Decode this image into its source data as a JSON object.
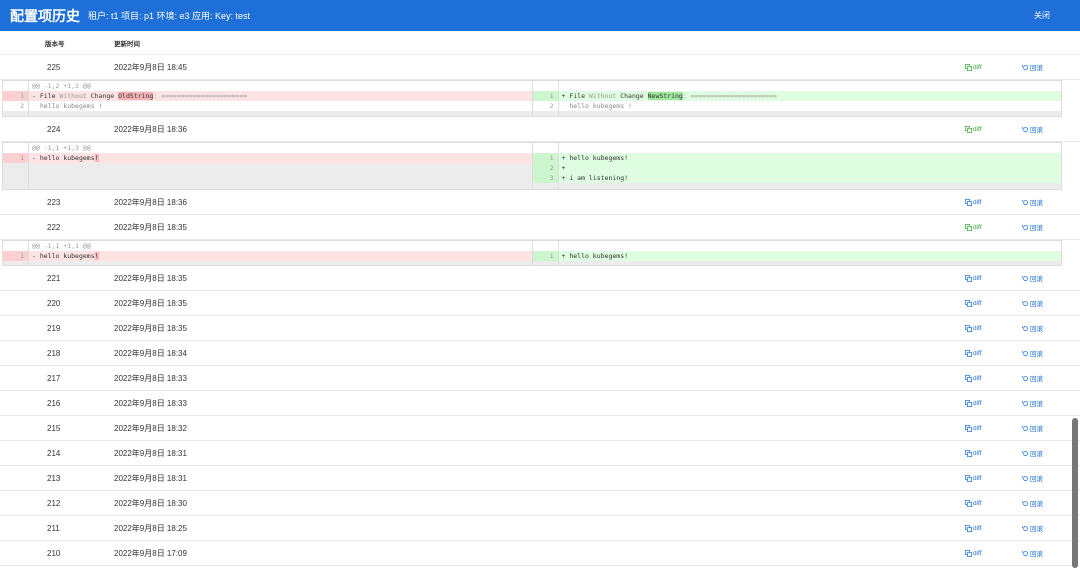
{
  "header": {
    "title": "配置项历史",
    "subtitle": "租户: t1 项目: p1 环境: e3 应用: Key: test",
    "close_label": "关闭"
  },
  "table": {
    "columns": [
      "版本号",
      "更新时间"
    ],
    "diff_label": "diff",
    "rollback_label": "回滚",
    "rows": [
      {
        "version": "225",
        "time": "2022年9月8日 18:45"
      },
      {
        "version": "224",
        "time": "2022年9月8日 18:36"
      },
      {
        "version": "223",
        "time": "2022年9月8日 18:36"
      },
      {
        "version": "222",
        "time": "2022年9月8日 18:35"
      },
      {
        "version": "221",
        "time": "2022年9月8日 18:35"
      },
      {
        "version": "220",
        "time": "2022年9月8日 18:35"
      },
      {
        "version": "219",
        "time": "2022年9月8日 18:35"
      },
      {
        "version": "218",
        "time": "2022年9月8日 18:34"
      },
      {
        "version": "217",
        "time": "2022年9月8日 18:33"
      },
      {
        "version": "216",
        "time": "2022年9月8日 18:33"
      },
      {
        "version": "215",
        "time": "2022年9月8日 18:32"
      },
      {
        "version": "214",
        "time": "2022年9月8日 18:31"
      },
      {
        "version": "213",
        "time": "2022年9月8日 18:31"
      },
      {
        "version": "212",
        "time": "2022年9月8日 18:30"
      },
      {
        "version": "211",
        "time": "2022年9月8日 18:25"
      },
      {
        "version": "210",
        "time": "2022年9月8日 17:09"
      }
    ]
  },
  "diffs": {
    "d225": {
      "hunk": "@@ -1,2 +1,2 @@",
      "left": [
        {
          "n": "1",
          "type": "del",
          "pre": "- File ",
          "w1": "Without",
          "mid": " Change ",
          "mark": "OldString",
          "post": ": ======================"
        },
        {
          "n": "2",
          "type": "ctx",
          "text": "  hello kubegems !"
        }
      ],
      "right": [
        {
          "n": "1",
          "type": "add",
          "pre": "+ File ",
          "w1": "Without",
          "mid": " Change ",
          "mark": "NewString",
          "post": ": ======================"
        },
        {
          "n": "2",
          "type": "ctx",
          "text": "  hello kubegems !"
        }
      ]
    },
    "d224": {
      "hunk": "@@ -1,1 +1,3 @@",
      "left": [
        {
          "n": "1",
          "type": "del",
          "text": "- hello kubegems",
          "mark": "!"
        }
      ],
      "right": [
        {
          "n": "1",
          "type": "add",
          "text": "+ hello kubegems!"
        },
        {
          "n": "2",
          "type": "add",
          "text": "+"
        },
        {
          "n": "3",
          "type": "add",
          "text": "+ i am listening!"
        }
      ]
    },
    "d222": {
      "hunk": "@@ -1,1 +1,1 @@",
      "left": [
        {
          "n": "1",
          "type": "del",
          "text": "- hello kubegems",
          "mark": "!"
        }
      ],
      "right": [
        {
          "n": "1",
          "type": "add",
          "text": "+ hello kubegems!"
        }
      ]
    }
  },
  "colors": {
    "header_bg": "#1f6fd8",
    "link": "#1f6fd8",
    "diff_active": "#3aa53a"
  }
}
